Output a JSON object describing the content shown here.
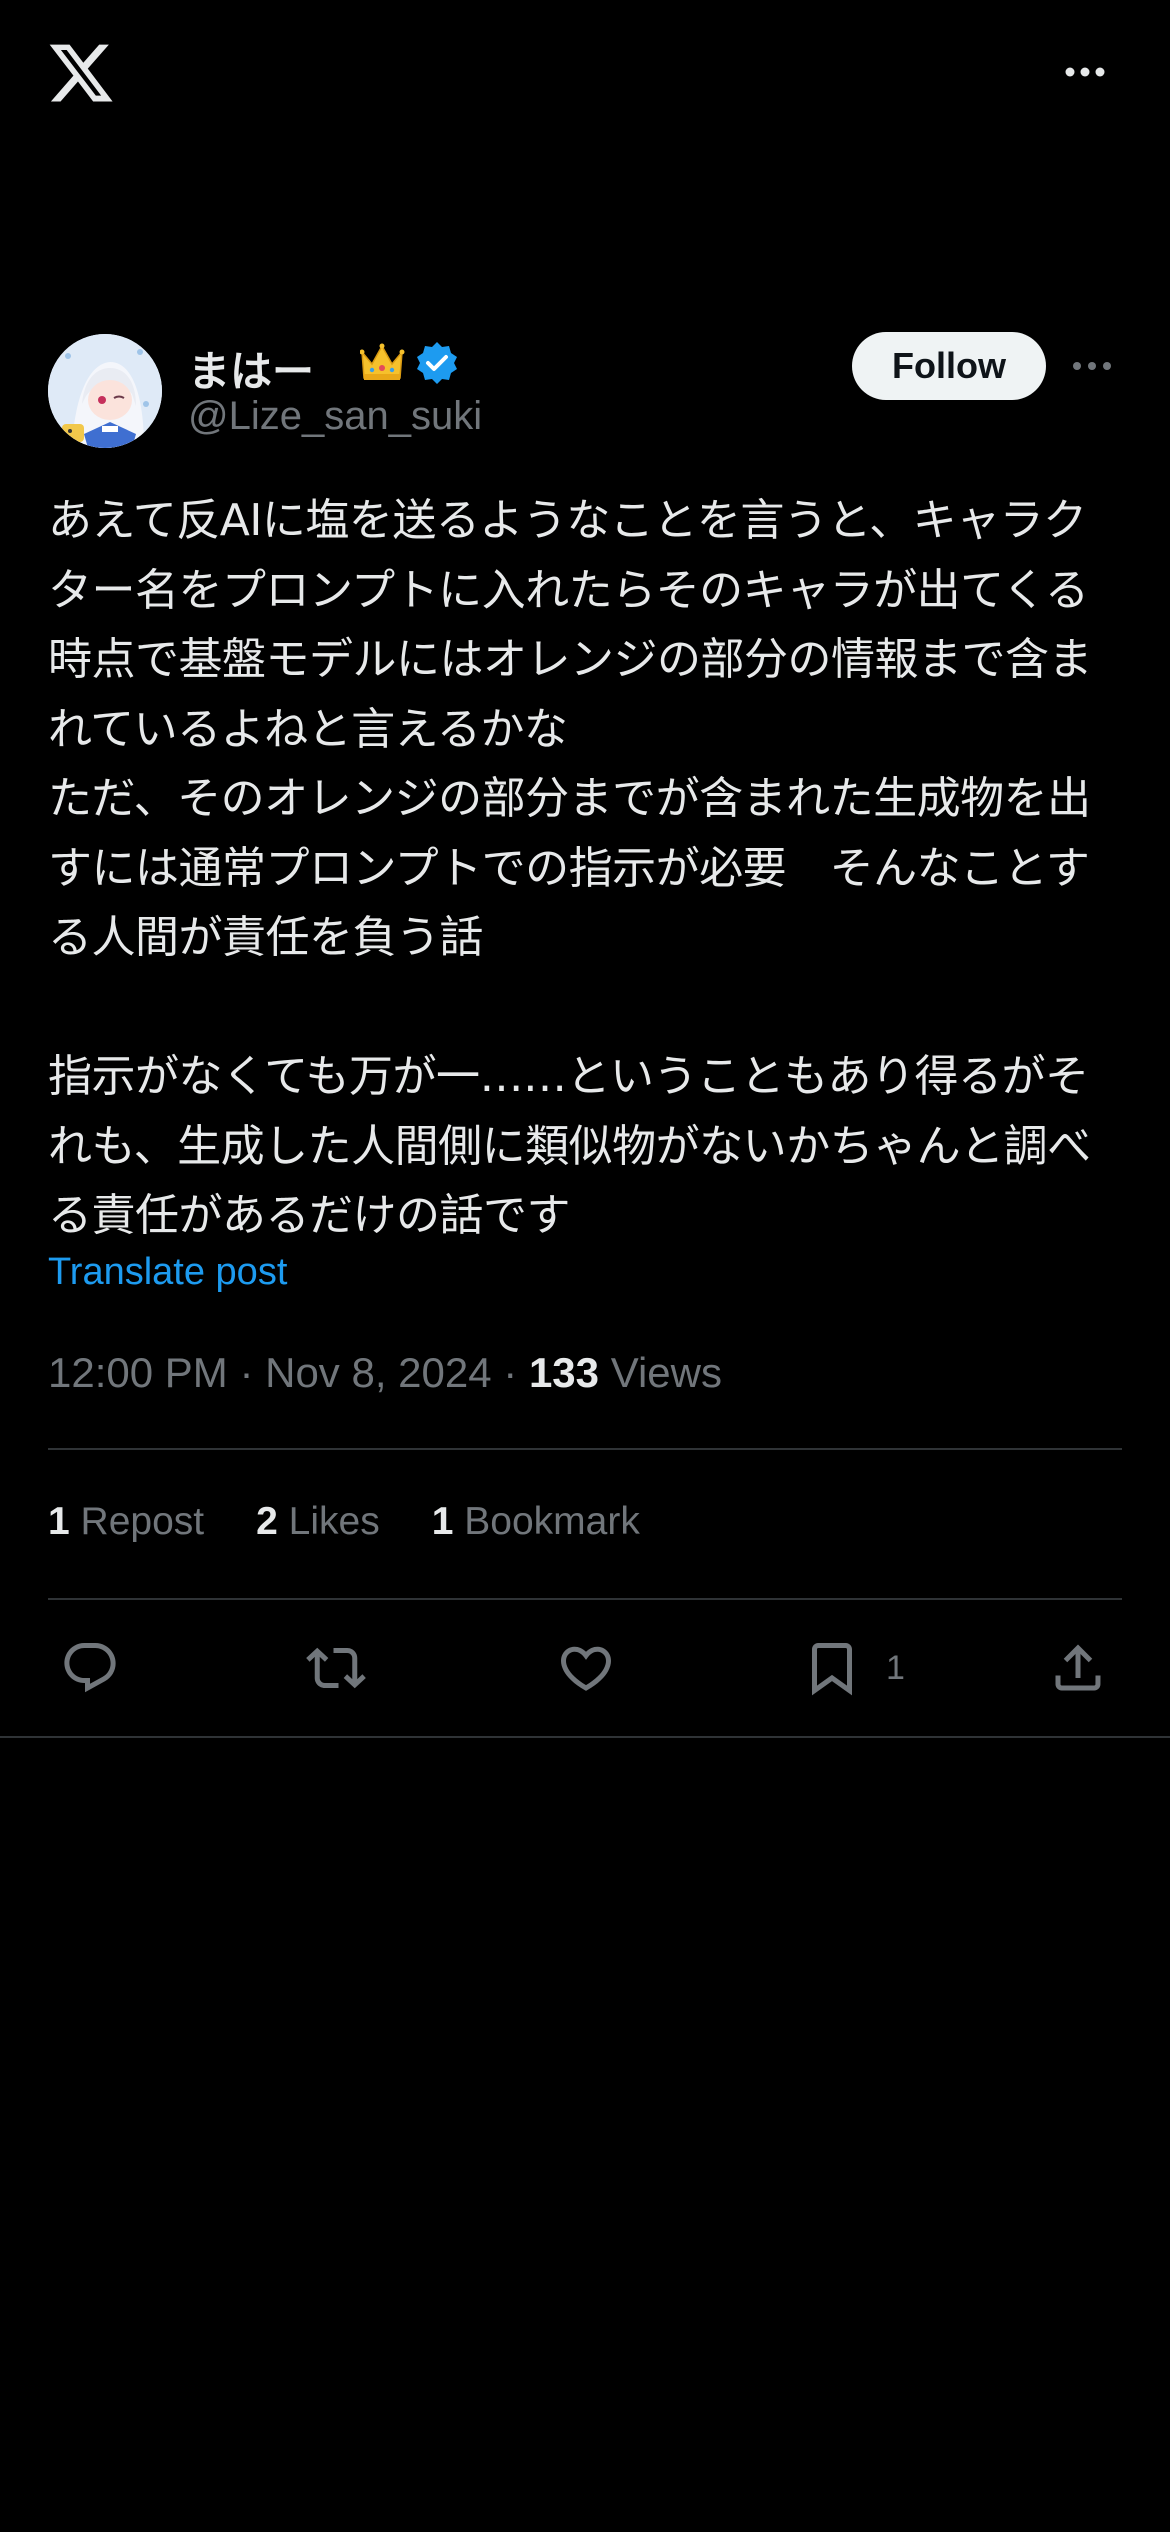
{
  "author": {
    "name": "まはー",
    "handle": "@Lize_san_suki",
    "follow_label": "Follow"
  },
  "post": {
    "text": "あえて反AIに塩を送るようなことを言うと、キャラクター名をプロンプトに入れたらそのキャラが出てくる時点で基盤モデルにはオレンジの部分の情報まで含まれているよねと言えるかな\nただ、そのオレンジの部分までが含まれた生成物を出すには通常プロンプトでの指示が必要　そんなことする人間が責任を負う話\n\n指示がなくても万が一……ということもあり得るがそれも、生成した人間側に類似物がないかちゃんと調べる責任があるだけの話です",
    "translate_label": "Translate post",
    "time": "12:00 PM",
    "date": "Nov 8, 2024",
    "views_count": "133",
    "views_label": "Views"
  },
  "stats": {
    "reposts_count": "1",
    "reposts_label": "Repost",
    "likes_count": "2",
    "likes_label": "Likes",
    "bookmarks_count": "1",
    "bookmarks_label": "Bookmark"
  },
  "actions": {
    "bookmark_count": "1"
  },
  "colors": {
    "background": "#000000",
    "text": "#e7e9ea",
    "muted": "#71767b",
    "link": "#1d9bf0",
    "verified": "#1d9bf0",
    "divider": "#2f3336"
  },
  "icons": {
    "logo": "x-logo-icon",
    "more": "more-horizontal-icon",
    "verified": "verified-badge-icon",
    "crown": "crown-emoji-icon",
    "reply": "reply-icon",
    "repost": "repost-icon",
    "like": "heart-icon",
    "bookmark": "bookmark-icon",
    "share": "share-icon"
  }
}
